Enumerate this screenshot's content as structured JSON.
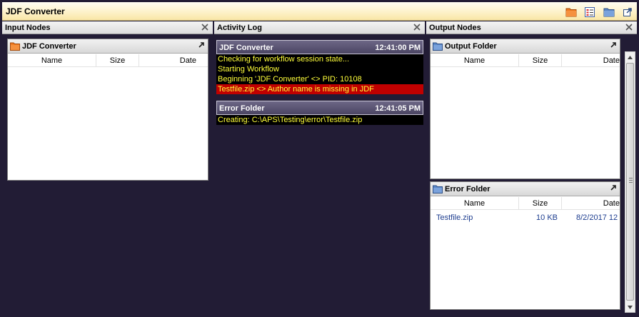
{
  "window": {
    "title": "JDF Converter"
  },
  "toolbar": {
    "buttons": [
      "folder-orange-icon",
      "checklist-icon",
      "folder-blue-icon",
      "pop-out-icon"
    ]
  },
  "input_panel": {
    "title": "Input Nodes",
    "nodes": [
      {
        "title": "JDF Converter",
        "icon": "folder-orange-icon",
        "columns": [
          "Name",
          "Size",
          "Date"
        ],
        "rows": []
      }
    ]
  },
  "activity_panel": {
    "title": "Activity Log",
    "blocks": [
      {
        "title": "JDF Converter",
        "time": "12:41:00 PM",
        "lines": [
          {
            "text": "Checking for workflow session state...",
            "level": "info"
          },
          {
            "text": "Starting Workflow",
            "level": "info"
          },
          {
            "text": "Beginning 'JDF Converter' <> PID: 10108",
            "level": "info"
          },
          {
            "text": "Testfile.zip <> Author name is missing in JDF",
            "level": "error"
          }
        ]
      },
      {
        "title": "Error Folder",
        "time": "12:41:05 PM",
        "lines": [
          {
            "text": "Creating: C:\\APS\\Testing\\error\\Testfile.zip",
            "level": "info"
          }
        ]
      }
    ]
  },
  "output_panel": {
    "title": "Output Nodes",
    "nodes": [
      {
        "title": "Output Folder",
        "icon": "folder-blue-icon",
        "columns": [
          "Name",
          "Size",
          "Date"
        ],
        "rows": []
      },
      {
        "title": "Error Folder",
        "icon": "folder-blue-icon",
        "columns": [
          "Name",
          "Size",
          "Date"
        ],
        "rows": [
          {
            "name": "Testfile.zip",
            "size": "10 KB",
            "date": "8/2/2017 12"
          }
        ]
      }
    ]
  },
  "colors": {
    "background": "#221c35",
    "log_text": "#ffff3a",
    "log_error_bg": "#c00000",
    "file_text": "#1d3d8f",
    "folder_orange": "#f07b22",
    "folder_blue": "#5b87c7"
  }
}
